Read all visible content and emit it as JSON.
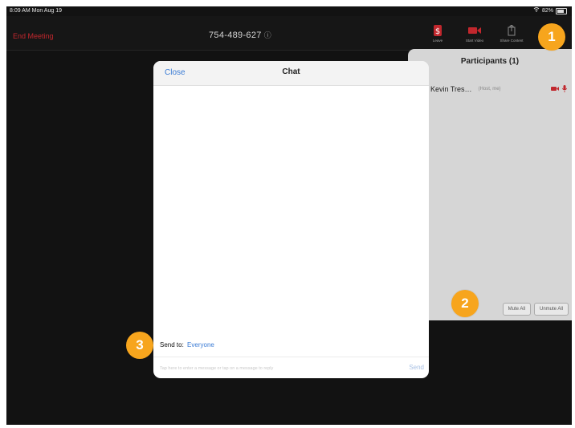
{
  "status_bar": {
    "time": "8:09 AM  Mon Aug 19",
    "battery": "82%"
  },
  "top_bar": {
    "end_meeting_label": "End Meeting",
    "meeting_id": "754-489-627",
    "toolbar": [
      {
        "label": "Leave",
        "icon": "dollar-icon",
        "color": "#c1272d"
      },
      {
        "label": "Start Video",
        "icon": "video-icon",
        "color": "#c1272d"
      },
      {
        "label": "Share Content",
        "icon": "share-icon",
        "color": "#8a8a8a"
      },
      {
        "label": "Participants",
        "icon": "participants-icon",
        "color": "#bdbdbd"
      }
    ]
  },
  "participants_panel": {
    "title": "Participants (1)",
    "participant": {
      "name": "Kevin Tres…",
      "role": "(Host, me)"
    },
    "actions": {
      "mute_all": "Mute All",
      "unmute_all": "Unmute All"
    }
  },
  "chat": {
    "close_label": "Close",
    "title": "Chat",
    "send_to_prefix": "Send to:",
    "send_to_target": "Everyone",
    "input_placeholder": "Tap here to enter a message or tap on a message to reply",
    "send_label": "Send"
  },
  "callouts": [
    "1",
    "2",
    "3"
  ],
  "colors": {
    "accent_orange": "#f7a51d",
    "link_blue": "#3a7bd5",
    "danger_red": "#c1272d"
  }
}
